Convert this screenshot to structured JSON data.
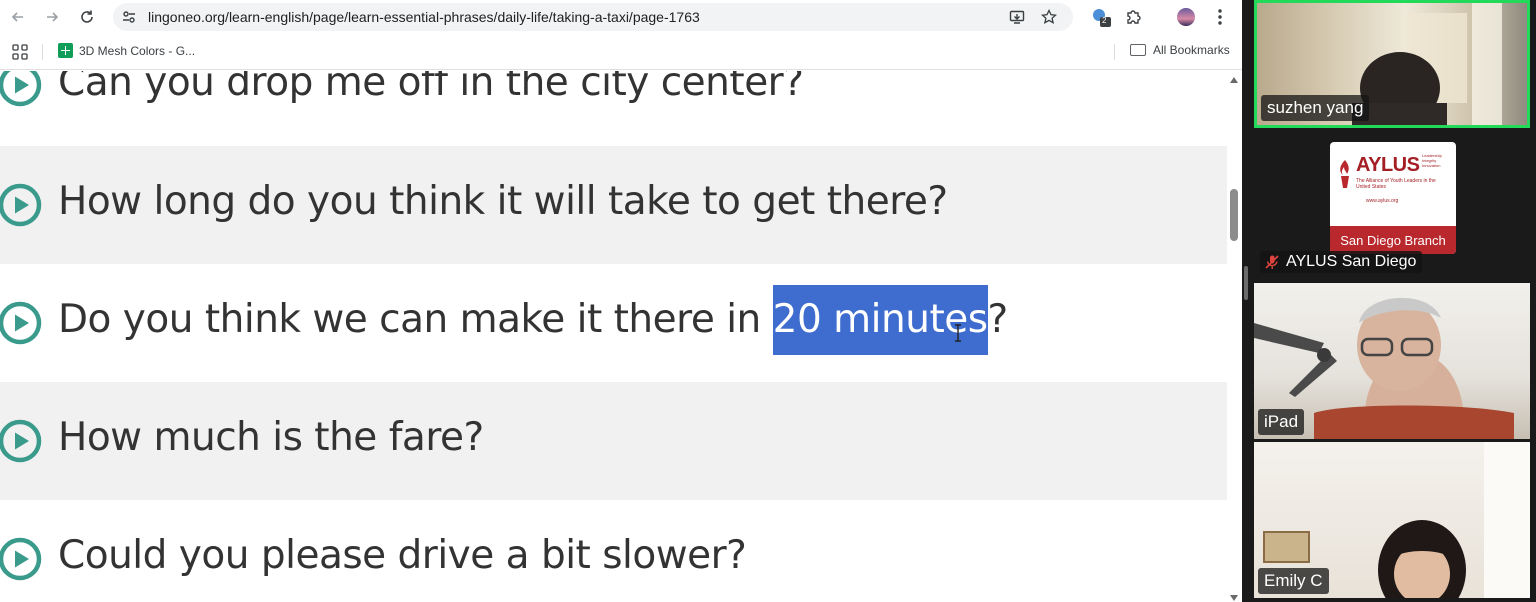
{
  "browser": {
    "url": "lingoneo.org/learn-english/page/learn-essential-phrases/daily-life/taking-a-taxi/page-1763",
    "extension_badge": "2",
    "bookmarks": {
      "item_label": "3D Mesh Colors - G...",
      "all_label": "All Bookmarks"
    }
  },
  "page": {
    "phrases": [
      {
        "text": "Can you drop me off in the city center?"
      },
      {
        "text": "How long do you think it will take to get there?"
      },
      {
        "before": "Do you think we can make it there in ",
        "selected": "20 minutes",
        "after": "?"
      },
      {
        "text": "How much is the fare?"
      },
      {
        "text": "Could you please drive a bit slower?"
      }
    ],
    "accent_color": "#3a9a8c",
    "selection_color": "#3e6ccf"
  },
  "meeting": {
    "participants": [
      {
        "name": "suzhen  yang",
        "active": true
      },
      {
        "name": "AYLUS San Diego",
        "muted": true,
        "logo_title": "AYLUS",
        "logo_tagline": "Leadership Integrity Innovation",
        "logo_org": "The Alliance of Youth Leaders in the United States",
        "logo_url": "www.aylus.org",
        "logo_band": "San Diego Branch"
      },
      {
        "name": "iPad"
      },
      {
        "name": "Emily C"
      }
    ],
    "active_border_color": "#23d959"
  }
}
